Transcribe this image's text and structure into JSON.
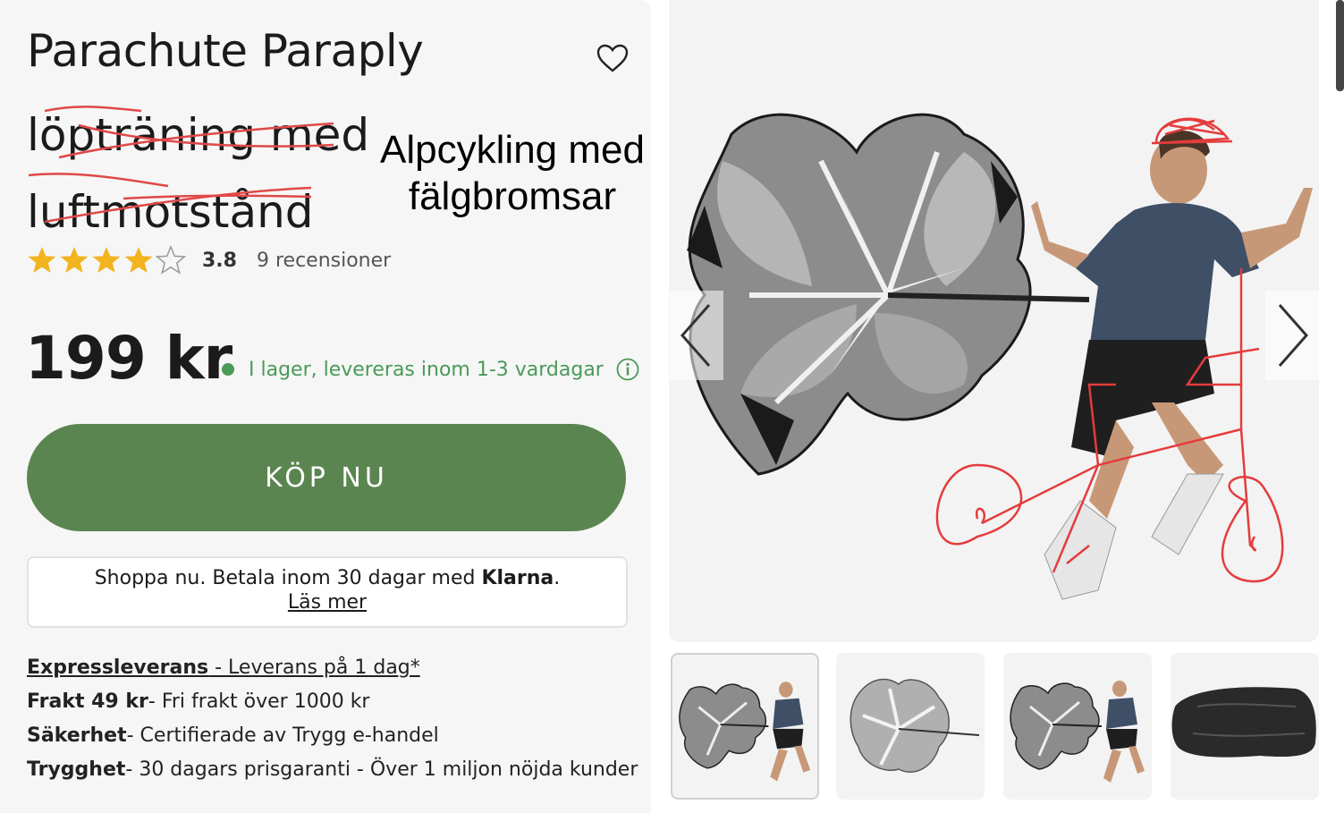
{
  "product": {
    "title": "Parachute Paraply",
    "subtitle": "löpträning med luftmotstånd",
    "handwritten_note": "Alpcykling med fälgbromsar",
    "rating": 3.8,
    "rating_label": "3.8",
    "reviews_label": "9 recensioner",
    "price": "199 kr",
    "stock": "I lager, levereras inom 1-3 vardagar",
    "favorite_icon": "heart-icon",
    "info_icon": "info-icon"
  },
  "buy_button": {
    "label": "KÖP NU"
  },
  "klarna": {
    "text": "Shoppa nu. Betala inom 30 dagar med ",
    "brand": "Klarna",
    "suffix": ".",
    "link": "Läs mer"
  },
  "info": [
    {
      "bold": "Expressleverans",
      "text": " - Leverans på 1 dag*"
    },
    {
      "bold": "Frakt 49 kr",
      "text": "- Fri frakt över 1000 kr"
    },
    {
      "bold": "Säkerhet",
      "text": "- Certifierade av Trygg e-handel"
    },
    {
      "bold": "Trygghet",
      "text": "- 30 dagars prisgaranti - Över 1 miljon nöjda kunder"
    }
  ],
  "gallery": {
    "prev_icon": "chevron-left-icon",
    "next_icon": "chevron-right-icon",
    "thumbnails": [
      "runner-with-parachute",
      "parachute-closeup",
      "runner-with-parachute",
      "parachute-bag"
    ],
    "selected_index": 0
  },
  "colors": {
    "accent_green": "#5b8550",
    "stock_green": "#4a9a58",
    "star": "#f2b41e",
    "annotation_red": "#e43c3c"
  }
}
